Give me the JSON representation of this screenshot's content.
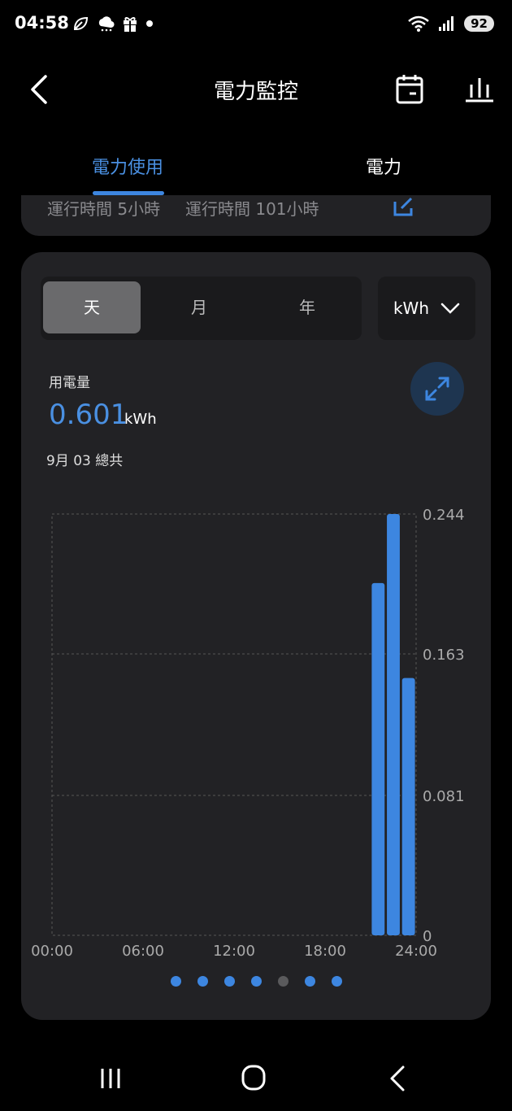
{
  "status_bar": {
    "time": "04:58",
    "icons": [
      "leaf-icon",
      "weather-icon",
      "gift-icon",
      "dot-icon"
    ],
    "right_icons": [
      "wifi-icon",
      "signal-icon"
    ],
    "battery": "92"
  },
  "header": {
    "title": "電力監控",
    "back_icon": "back-arrow-icon",
    "calendar_icon": "calendar-icon",
    "chart_icon": "bar-chart-icon"
  },
  "tabs": [
    {
      "label": "電力使用",
      "active": true
    },
    {
      "label": "電力",
      "active": false
    }
  ],
  "info_card": {
    "runtime_1": "運行時間 5小時",
    "runtime_2": "運行時間 101小時"
  },
  "period_selector": {
    "options": [
      "天",
      "月",
      "年"
    ],
    "selected": "天"
  },
  "unit_selector": {
    "value": "kWh"
  },
  "usage": {
    "label": "用電量",
    "value": "0.601",
    "unit": "kWh",
    "date_total": "9月 03 總共"
  },
  "colors": {
    "accent": "#3d86e0",
    "card_bg": "#222225",
    "page_bg": "#000000"
  },
  "chart_data": {
    "type": "bar",
    "x": [
      21.5,
      22.5,
      23.5
    ],
    "values": [
      0.204,
      0.244,
      0.149
    ],
    "xlim": [
      0,
      24
    ],
    "ylim": [
      0,
      0.244
    ],
    "x_ticks": [
      "00:00",
      "06:00",
      "12:00",
      "18:00",
      "24:00"
    ],
    "x_tick_values": [
      0,
      6,
      12,
      18,
      24
    ],
    "y_ticks": [
      "0",
      "0.081",
      "0.163",
      "0.244"
    ],
    "y_tick_values": [
      0,
      0.081,
      0.163,
      0.244
    ],
    "grid": true,
    "color": "#3d86e0"
  },
  "pager": {
    "count": 7,
    "active_index": 4
  },
  "nav_bar": [
    "recents-icon",
    "home-icon",
    "back-icon"
  ]
}
